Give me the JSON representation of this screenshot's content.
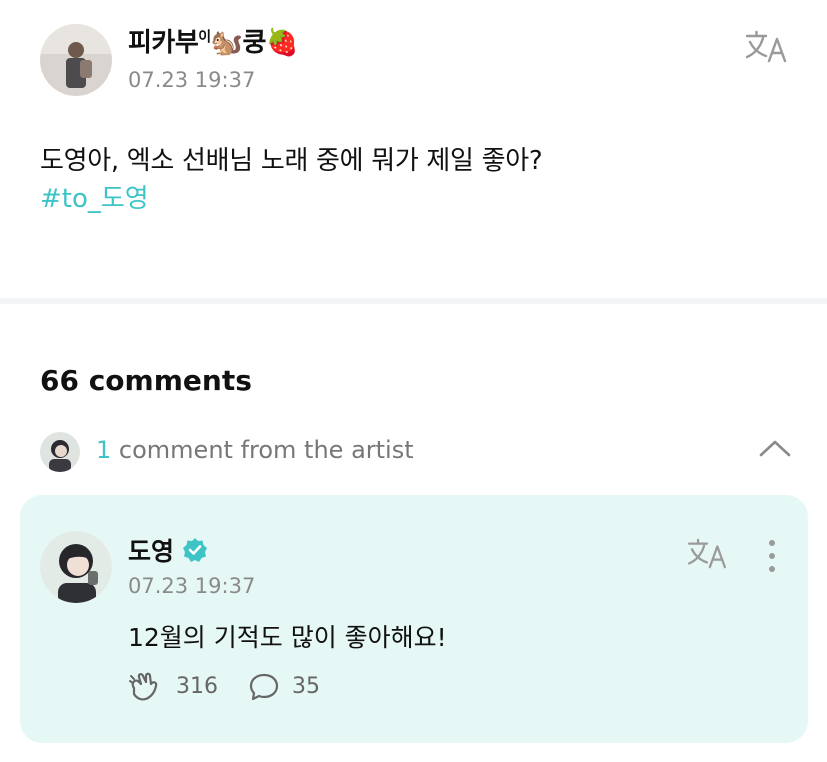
{
  "post": {
    "author": "피카부이🐿️쿵🍓",
    "author_parts": {
      "name": "피카부",
      "sup": "이",
      "emoji_1": "🐿️",
      "name_2": "쿵",
      "emoji_2": "🍓"
    },
    "timestamp": "07.23 19:37",
    "text": "도영아, 엑소 선배님 노래 중에 뭐가 제일 좋아?",
    "hashtag": "#to_도영",
    "translate_icon": "translate-icon"
  },
  "comments": {
    "count_label": "66 comments",
    "artist_section": {
      "count": "1",
      "label": "comment from the artist",
      "toggle_icon": "chevron-up-icon"
    },
    "artist_comment": {
      "author": "도영",
      "verified_icon": "verified-badge-icon",
      "timestamp": "07.23 19:37",
      "text": "12월의 기적도 많이 좋아해요!",
      "likes": "316",
      "replies": "35",
      "like_icon": "heart-clap-icon",
      "reply_icon": "speech-bubble-icon",
      "more_icon": "more-vertical-icon"
    }
  },
  "colors": {
    "accent": "#3ec4c7",
    "card_bg": "#e6f8f6",
    "muted_text": "#8a8a8a",
    "divider": "#f3f4f6"
  }
}
